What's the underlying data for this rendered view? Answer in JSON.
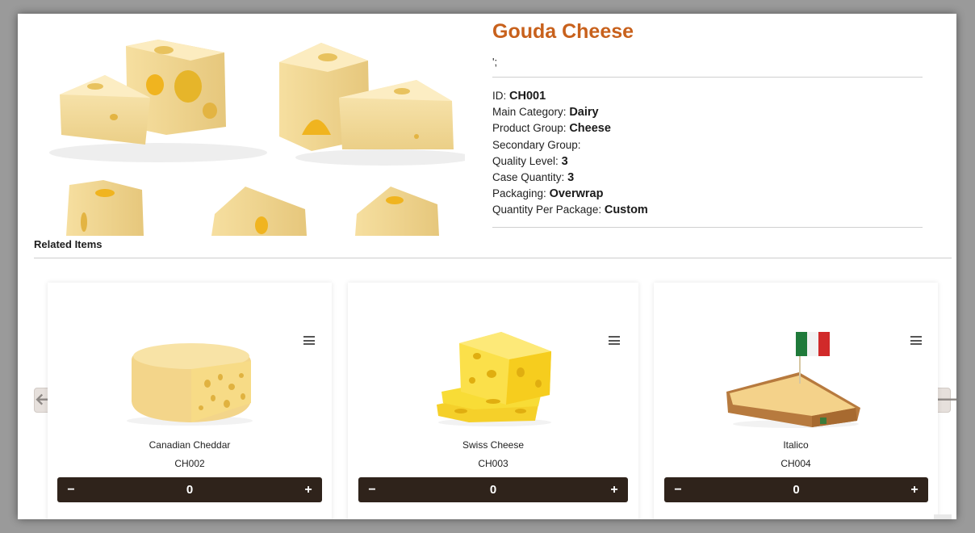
{
  "product": {
    "title": "Gouda Cheese",
    "snippet": "';",
    "image_icon": "cheese-wedges-image",
    "specs": [
      {
        "label": "ID:",
        "value": "CH001"
      },
      {
        "label": "Main Category:",
        "value": "Dairy"
      },
      {
        "label": "Product Group:",
        "value": "Cheese"
      },
      {
        "label": "Secondary Group:",
        "value": ""
      },
      {
        "label": "Quality Level:",
        "value": "3"
      },
      {
        "label": "Case Quantity:",
        "value": "3"
      },
      {
        "label": "Packaging:",
        "value": "Overwrap"
      },
      {
        "label": "Quantity Per Package:",
        "value": "Custom"
      }
    ]
  },
  "related": {
    "title": "Related Items",
    "prev_icon": "arrow-left-icon",
    "next_icon": "arrow-right-icon",
    "prev_label": "🡐",
    "next_label": "🡒",
    "items": [
      {
        "name": "Canadian Cheddar",
        "id": "CH002",
        "quantity": "0",
        "minus": "−",
        "plus": "+"
      },
      {
        "name": "Swiss Cheese",
        "id": "CH003",
        "quantity": "0",
        "minus": "−",
        "plus": "+"
      },
      {
        "name": "Italico",
        "id": "CH004",
        "quantity": "0",
        "minus": "−",
        "plus": "+"
      }
    ]
  },
  "colors": {
    "title": "#c8611c",
    "qty_bar": "#2f231b",
    "cheese": "#f3d99a",
    "hole": "#f0b41f"
  }
}
